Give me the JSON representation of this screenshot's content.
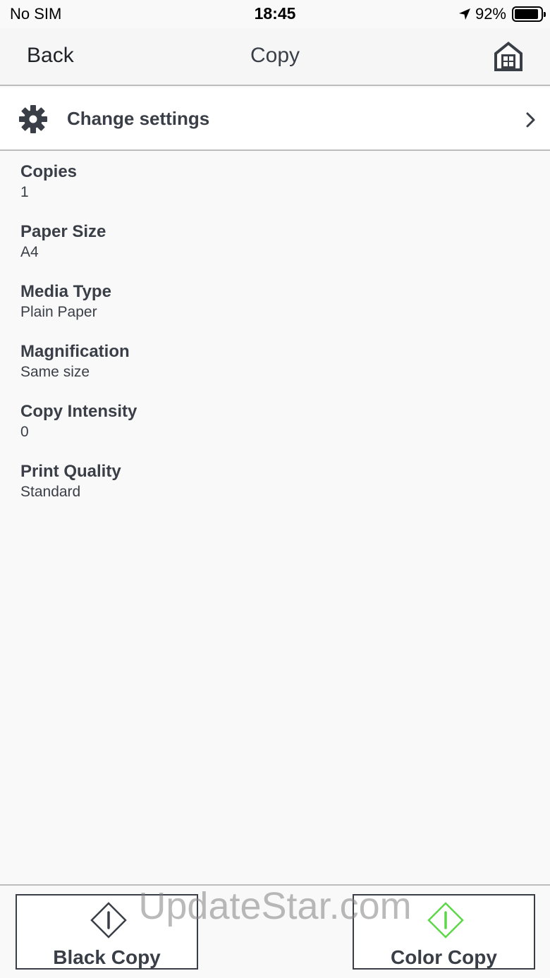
{
  "status_bar": {
    "carrier": "No SIM",
    "time": "18:45",
    "battery": "92%",
    "battery_level": 0.92
  },
  "nav": {
    "back_label": "Back",
    "title": "Copy",
    "home_icon": "home-icon"
  },
  "settings_row": {
    "icon": "gear-icon",
    "label": "Change settings",
    "chevron": "chevron-right-icon"
  },
  "settings": [
    {
      "label": "Copies",
      "value": "1"
    },
    {
      "label": "Paper Size",
      "value": "A4"
    },
    {
      "label": "Media Type",
      "value": "Plain Paper"
    },
    {
      "label": "Magnification",
      "value": "Same size"
    },
    {
      "label": "Copy Intensity",
      "value": "0"
    },
    {
      "label": "Print Quality",
      "value": "Standard"
    }
  ],
  "buttons": {
    "black_copy": {
      "label": "Black Copy",
      "icon": "start-diamond-icon",
      "color": "#3a3f47"
    },
    "color_copy": {
      "label": "Color Copy",
      "icon": "start-diamond-icon",
      "color": "#5ed64a"
    }
  },
  "watermark": "UpdateStar.com",
  "colors": {
    "background": "#f9f9fa",
    "text": "#3a3f47",
    "separator": "#bdbdbd",
    "accent_green": "#5ed64a"
  }
}
